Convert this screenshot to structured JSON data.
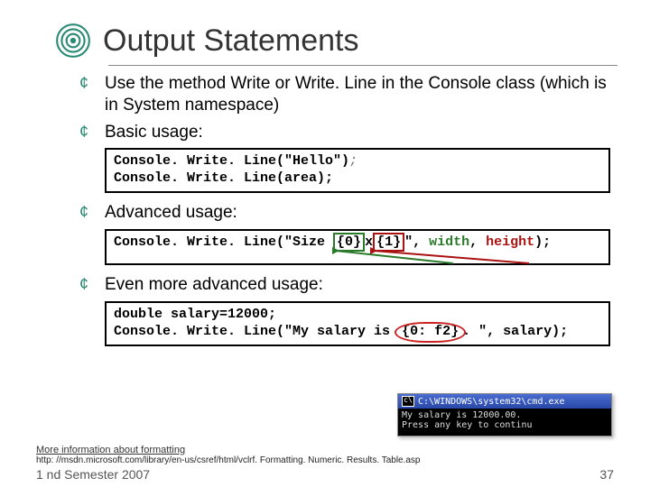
{
  "title": "Output Statements",
  "bullets": {
    "b1": "Use the method Write or Write. Line in the Console class (which is in System namespace)",
    "b2": "Basic usage:",
    "b3": "Advanced usage:",
    "b4": "Even more advanced usage:"
  },
  "code1": {
    "l1a": "Console. Write. Line(\"Hello\")",
    "l1b": ";",
    "l2": "Console. Write. Line(area);"
  },
  "code2": {
    "lead": "Console. Write. Line(",
    "str1": "\"Size ",
    "ph0": "{0}",
    "mid": "x",
    "ph1": "{1}",
    "str2": "\"",
    "sep": ", ",
    "arg0": "width",
    "sep2": ", ",
    "arg1": "height",
    "tail": ");"
  },
  "code3": {
    "l1": "double salary=12000;",
    "l2a": "Console. Write. Line(\"My salary is ",
    "ph": "{0: f2}",
    "l2b": ". \", salary);"
  },
  "cmd": {
    "title": "C:\\WINDOWS\\system32\\cmd.exe",
    "body": "My salary is 12000.00.\nPress any key to continu"
  },
  "footer": {
    "more": "More information about formatting",
    "url": "http: //msdn.microsoft.com/library/en-us/csref/html/vclrf. Formatting. Numeric. Results. Table.asp",
    "sem": "1 nd Semester 2007",
    "page": "37"
  }
}
